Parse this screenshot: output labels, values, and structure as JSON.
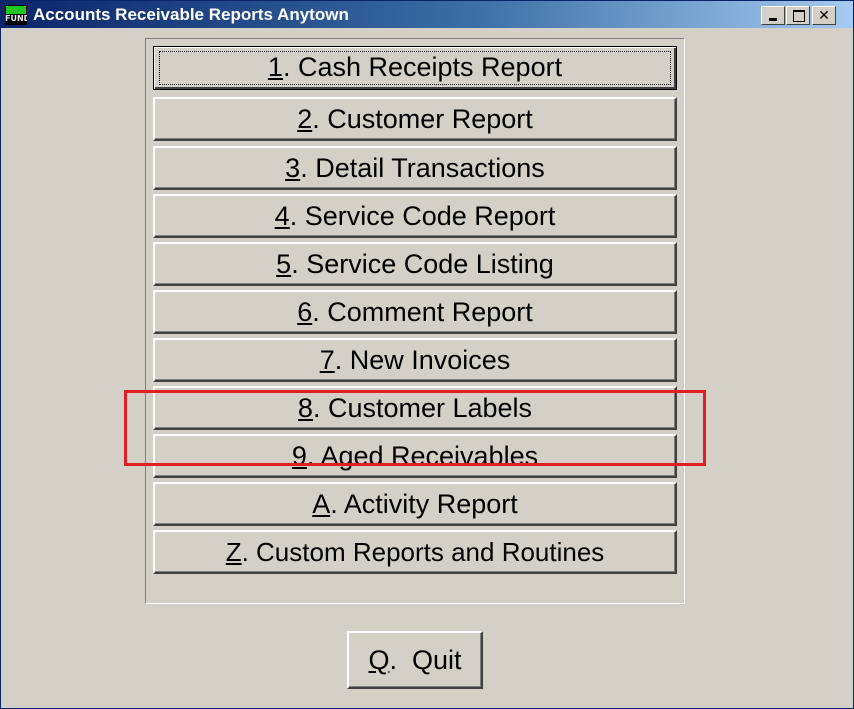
{
  "window": {
    "title": "Accounts Receivable Reports Anytown",
    "icon_label": "FUND",
    "controls": {
      "minimize": "minimize-icon",
      "maximize": "maximize-icon",
      "close": "✕"
    }
  },
  "menu": {
    "items": [
      {
        "key": "1",
        "rest": ". Cash Receipts Report"
      },
      {
        "key": "2",
        "rest": ". Customer Report"
      },
      {
        "key": "3",
        "rest": ". Detail Transactions"
      },
      {
        "key": "4",
        "rest": ". Service Code Report"
      },
      {
        "key": "5",
        "rest": ". Service Code Listing"
      },
      {
        "key": "6",
        "rest": ". Comment Report"
      },
      {
        "key": "7",
        "rest": ". New Invoices"
      },
      {
        "key": "8",
        "rest": ". Customer Labels"
      },
      {
        "key": "9",
        "rest": ". Aged Receivables"
      },
      {
        "key": "A",
        "rest": ". Activity Report"
      },
      {
        "key": "Z",
        "rest": ". Custom Reports and Routines"
      }
    ]
  },
  "quit": {
    "key": "Q",
    "rest": ".  Quit"
  },
  "colors": {
    "highlight": "#e02020",
    "titlebar_start": "#0a246a",
    "titlebar_end": "#a6caf0",
    "face": "#d4d0c8"
  }
}
